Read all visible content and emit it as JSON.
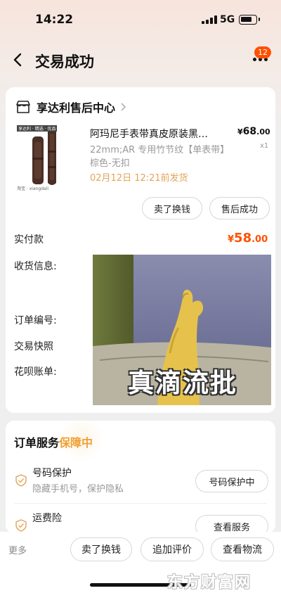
{
  "status_bar": {
    "time": "14:22",
    "network": "5G"
  },
  "nav": {
    "title": "交易成功",
    "badge_count": "12"
  },
  "shop": {
    "name": "享达利售后中心"
  },
  "product": {
    "image_tag": "享达利 · 精选 · 优品",
    "image_caption": "淘宝 · xiangdali",
    "title": "阿玛尼手表带真皮原装黑…",
    "price_currency": "¥",
    "price_int": "68",
    "price_dec": ".00",
    "quantity": "x1",
    "sku": "22mm;AR 专用竹节纹【单表带】棕色-无扣",
    "ship_time": "02月12日 12:21前发货"
  },
  "actions": {
    "sell": "卖了换钱",
    "after_sale": "售后成功"
  },
  "order": {
    "paid_label": "实付款",
    "paid_currency": "¥",
    "paid_int": "58",
    "paid_dec": ".00",
    "address_label": "收货信息:",
    "order_no_label": "订单编号:",
    "snapshot_label": "交易快照",
    "huabei_label": "花呗账单:"
  },
  "meme": {
    "caption": "真滴流批"
  },
  "service": {
    "title": "订单服务",
    "title_highlight": "保障中",
    "items": [
      {
        "name": "号码保护",
        "desc": "隐藏手机号，保护隐私",
        "button": "号码保护中"
      },
      {
        "name": "运费险",
        "desc": "",
        "button": "查看服务"
      }
    ]
  },
  "bottom_bar": {
    "more": "更多",
    "buttons": [
      "卖了换钱",
      "追加评价",
      "查看物流"
    ],
    "watermark": "东方财富网"
  },
  "colors": {
    "accent": "#ff5000",
    "gold": "#f0a032",
    "ship_time": "#e2a55a"
  }
}
